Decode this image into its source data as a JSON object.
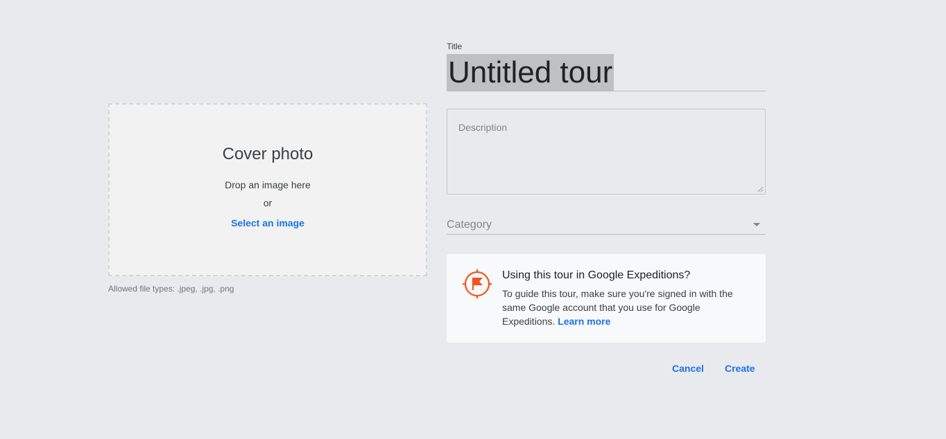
{
  "cover": {
    "title": "Cover photo",
    "drop_text": "Drop an image here",
    "or_text": "or",
    "select_label": "Select an image",
    "allowed_types": "Allowed file types: .jpeg, .jpg, .png"
  },
  "form": {
    "title_label": "Title",
    "title_value": "Untitled tour",
    "description_placeholder": "Description",
    "category_label": "Category"
  },
  "info": {
    "heading": "Using this tour in Google Expeditions?",
    "body": "To guide this tour, make sure you're signed in with the same Google account that you use for Google Expeditions.",
    "link_label": "Learn more",
    "icon": "expeditions-flag-icon",
    "icon_color": "#f4511e"
  },
  "actions": {
    "cancel_label": "Cancel",
    "create_label": "Create"
  },
  "colors": {
    "accent": "#1a73e8",
    "background": "#e9eaed"
  }
}
